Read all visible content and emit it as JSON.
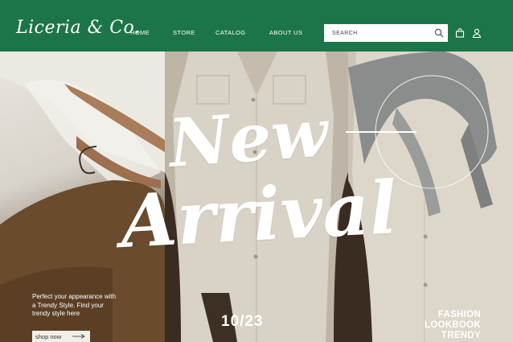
{
  "header": {
    "logo": "Liceria & Co.",
    "nav": [
      "HOME",
      "STORE",
      "CATALOG",
      "ABOUT US"
    ],
    "search_placeholder": "SEARCH",
    "background": "#1c7548"
  },
  "hero": {
    "headline_1": "New",
    "headline_2": "Arrival",
    "date": "10/23",
    "tagline": "Perfect your appearance with a Trendy Style. Find your trendy style here",
    "cta": "shop now",
    "side_text": [
      "FASHION",
      "LOOKBOOK",
      "TRENDY"
    ]
  },
  "icons": [
    "search-icon",
    "bag-icon",
    "user-icon",
    "arrow-right-icon"
  ]
}
